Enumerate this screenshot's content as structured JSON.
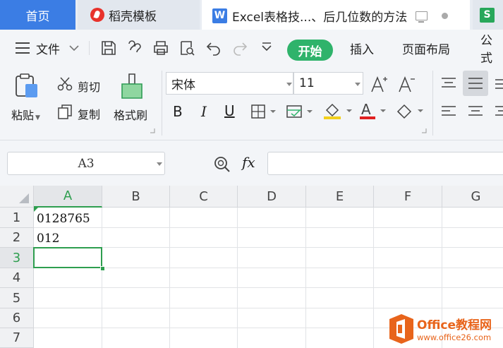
{
  "tabs": {
    "home": "首页",
    "template": "稻壳模板",
    "document": "Excel表格技...、后几位数的方法",
    "document_badge": "W",
    "last_badge": "S"
  },
  "menu": {
    "file": "文件",
    "start": "开始",
    "insert": "插入",
    "page_layout": "页面布局",
    "formula": "公式"
  },
  "ribbon": {
    "paste": "粘贴",
    "cut": "剪切",
    "copy": "复制",
    "format_painter": "格式刷",
    "font_name": "宋体",
    "font_size": "11",
    "bold": "B",
    "italic": "I",
    "underline": "U",
    "font_color_letter": "A"
  },
  "formula_bar": {
    "cell_ref": "A3",
    "fx": "fx",
    "content": ""
  },
  "sheet": {
    "columns": [
      "A",
      "B",
      "C",
      "D",
      "E",
      "F",
      "G"
    ],
    "rows": [
      "1",
      "2",
      "3",
      "4",
      "5",
      "6",
      "7"
    ],
    "cells": {
      "A1": "0128765",
      "A2": "012"
    },
    "active_cell": "A3"
  },
  "watermark": {
    "line1": "Office教程网",
    "line2": "www.office26.com"
  },
  "colors": {
    "accent_blue": "#3b7de4",
    "start_green": "#2fb36b",
    "selection_green": "#2e9e4f",
    "watermark_orange": "#e8641b"
  }
}
